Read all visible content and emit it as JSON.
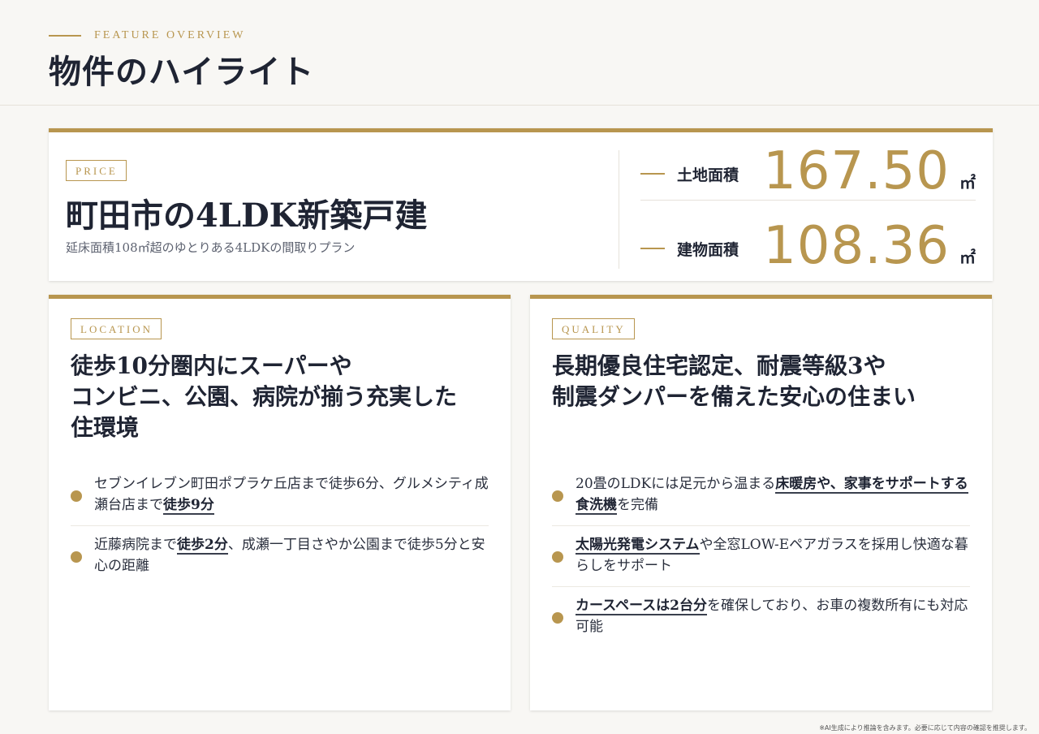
{
  "header": {
    "eyebrow": "FEATURE OVERVIEW",
    "title": "物件のハイライト"
  },
  "price_card": {
    "tag": "PRICE",
    "headline": "町田市の4LDK新築戸建",
    "subtitle": "延床面積108㎡超のゆとりある4LDKの間取りプラン",
    "areas": [
      {
        "label": "土地面積",
        "value": "167.50",
        "unit": "㎡"
      },
      {
        "label": "建物面積",
        "value": "108.36",
        "unit": "㎡"
      }
    ]
  },
  "location_card": {
    "tag": "LOCATION",
    "title_lines": [
      "徒歩10分圏内にスーパーや",
      "コンビニ、公園、病院が揃う充実した",
      "住環境"
    ],
    "bullets": [
      {
        "before": "セブンイレブン町田ポプラケ丘店まで徒歩6分、グルメシティ成瀬台店まで",
        "highlight": "徒歩9分",
        "after": ""
      },
      {
        "before": "近藤病院まで",
        "highlight": "徒歩2分",
        "after": "、成瀬一丁目さやか公園まで徒歩5分と安心の距離"
      }
    ]
  },
  "quality_card": {
    "tag": "QUALITY",
    "title_lines": [
      "長期優良住宅認定、耐震等級3や",
      "制震ダンパーを備えた安心の住まい"
    ],
    "bullets": [
      {
        "before": "20畳のLDKには足元から温まる",
        "highlight": "床暖房や、家事をサポートする食洗機",
        "after": "を完備"
      },
      {
        "before": "",
        "highlight": "太陽光発電システム",
        "after": "や全窓LOW-Eペアガラスを採用し快適な暮らしをサポート"
      },
      {
        "before": "",
        "highlight": "カースペースは2台分",
        "after": "を確保しており、お車の複数所有にも対応可能"
      }
    ]
  },
  "disclaimer": "※AI生成により推論を含みます。必要に応じて内容の確認を推奨します。",
  "colors": {
    "accent": "#b8964f",
    "text": "#1f2433",
    "background": "#f8f7f4"
  }
}
